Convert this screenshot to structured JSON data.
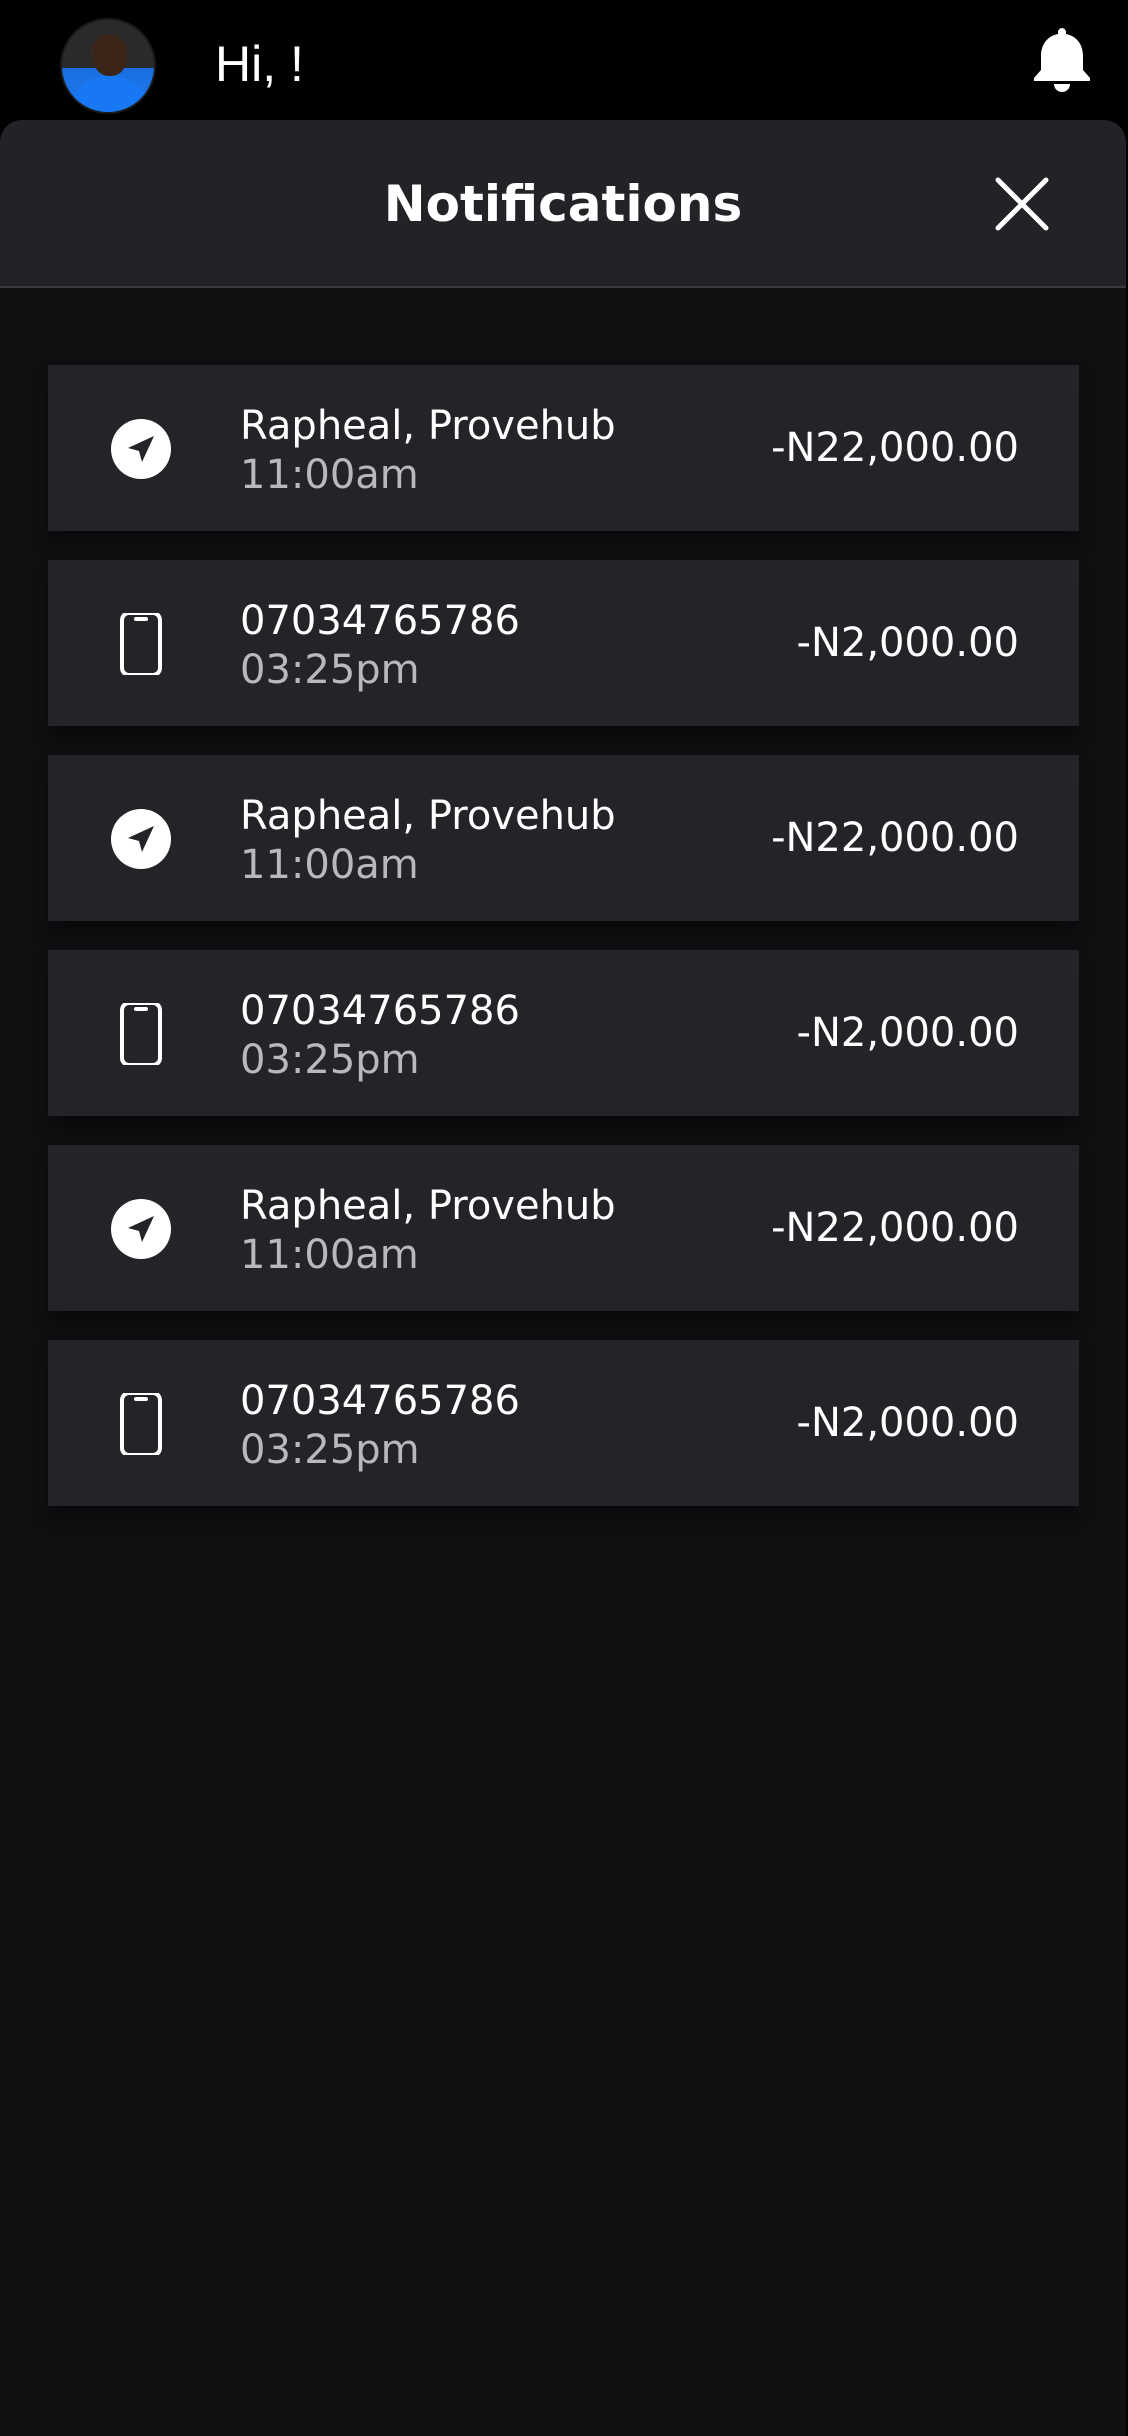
{
  "header": {
    "greeting": "Hi, !",
    "avatar_icon": "user-avatar",
    "bell_icon": "bell-icon"
  },
  "sheet": {
    "title": "Notifications",
    "close_icon": "close-icon"
  },
  "notifications": [
    {
      "icon": "navigation-arrow-icon",
      "title": "Rapheal, Provehub",
      "time": "11:00am",
      "amount": "-N22,000.00"
    },
    {
      "icon": "phone-icon",
      "title": "07034765786",
      "time": "03:25pm",
      "amount": "-N2,000.00"
    },
    {
      "icon": "navigation-arrow-icon",
      "title": "Rapheal, Provehub",
      "time": "11:00am",
      "amount": "-N22,000.00"
    },
    {
      "icon": "phone-icon",
      "title": "07034765786",
      "time": "03:25pm",
      "amount": "-N2,000.00"
    },
    {
      "icon": "navigation-arrow-icon",
      "title": "Rapheal, Provehub",
      "time": "11:00am",
      "amount": "-N22,000.00"
    },
    {
      "icon": "phone-icon",
      "title": "07034765786",
      "time": "03:25pm",
      "amount": "-N2,000.00"
    }
  ],
  "colors": {
    "background": "#000000",
    "sheet": "#0f1012",
    "card": "#232428",
    "text_primary": "#ffffff",
    "text_secondary": "#b9b9bd"
  }
}
